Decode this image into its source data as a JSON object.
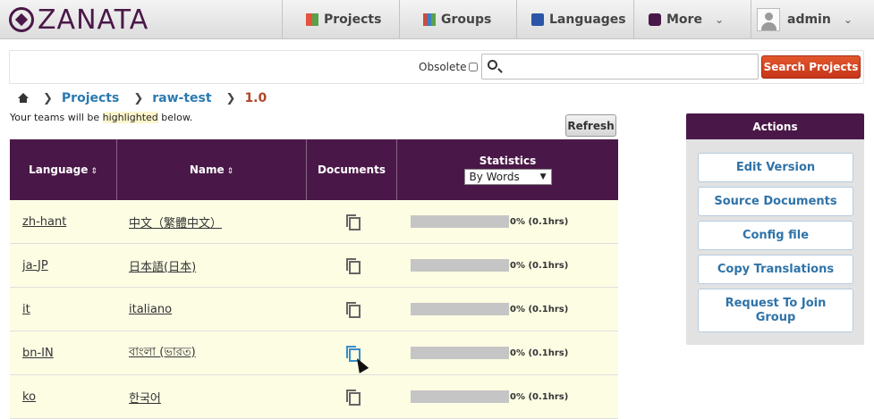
{
  "brand": {
    "name": "ZANATA"
  },
  "nav": {
    "projects": "Projects",
    "groups": "Groups",
    "languages": "Languages",
    "more": "More",
    "user": "admin"
  },
  "search": {
    "obsolete_label": "Obsolete",
    "placeholder": "",
    "button": "Search Projects"
  },
  "breadcrumb": {
    "projects": "Projects",
    "project": "raw-test",
    "version": "1.0"
  },
  "teams_note": {
    "before": "Your teams will be ",
    "highlight": "highlighted",
    "after": " below."
  },
  "refresh_button": "Refresh",
  "table": {
    "headers": {
      "language": "Language",
      "name": "Name",
      "documents": "Documents",
      "statistics": "Statistics",
      "stats_select": "By Words"
    },
    "rows": [
      {
        "code": "zh-hant",
        "name": "中文（繁體中文）",
        "progress": 0,
        "stat": "0% (0.1hrs)"
      },
      {
        "code": "ja-JP",
        "name": "日本語(日本)",
        "progress": 0,
        "stat": "0% (0.1hrs)"
      },
      {
        "code": "it",
        "name": "italiano",
        "progress": 0,
        "stat": "0% (0.1hrs)"
      },
      {
        "code": "bn-IN",
        "name": "বাংলা (ভারত)",
        "progress": 0,
        "stat": "0% (0.1hrs)"
      },
      {
        "code": "ko",
        "name": "한국어",
        "progress": 0,
        "stat": "0% (0.1hrs)"
      }
    ]
  },
  "actions": {
    "title": "Actions",
    "edit_version": "Edit Version",
    "source_documents": "Source Documents",
    "config_file": "Config file",
    "copy_translations": "Copy Translations",
    "request_join": "Request To Join Group"
  },
  "colors": {
    "brand_purple": "#4a1848",
    "link_blue": "#2a7ab0",
    "search_red": "#d0401f",
    "row_bg": "#fdfde4"
  }
}
